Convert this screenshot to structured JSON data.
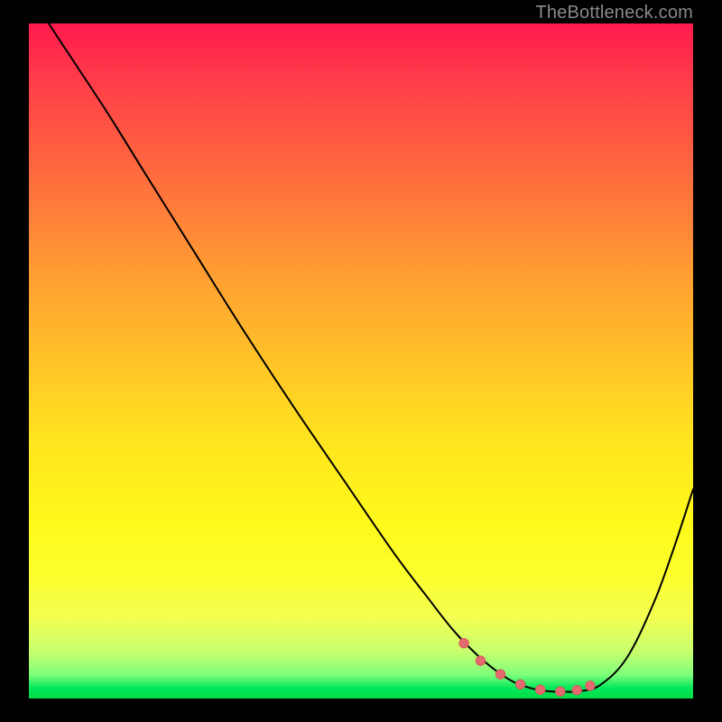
{
  "watermark": {
    "text": "TheBottleneck.com"
  },
  "colors": {
    "frame": "#000000",
    "curve": "#000000",
    "marker_fill": "#e46a6f",
    "marker_stroke": "#d95a60"
  },
  "chart_data": {
    "type": "line",
    "title": "",
    "xlabel": "",
    "ylabel": "",
    "xlim": [
      0,
      100
    ],
    "ylim": [
      0,
      100
    ],
    "series": [
      {
        "name": "curve",
        "x": [
          0,
          3,
          7,
          12,
          18,
          25,
          32,
          40,
          48,
          55,
          60,
          64,
          68,
          72,
          75,
          78,
          81,
          83,
          86,
          90,
          94,
          97,
          100
        ],
        "y": [
          105,
          100,
          94,
          86.5,
          77,
          66,
          55,
          43,
          31.5,
          21.5,
          15,
          10,
          6,
          3,
          1.7,
          1.1,
          1.0,
          1.1,
          2.0,
          6,
          14,
          22,
          31
        ]
      }
    ],
    "markers": {
      "name": "near-optimal-band",
      "x": [
        65.5,
        68,
        71,
        74,
        77,
        80,
        82.5,
        84.5
      ],
      "y": [
        8.2,
        5.6,
        3.6,
        2.1,
        1.3,
        1.05,
        1.25,
        1.9
      ]
    }
  }
}
